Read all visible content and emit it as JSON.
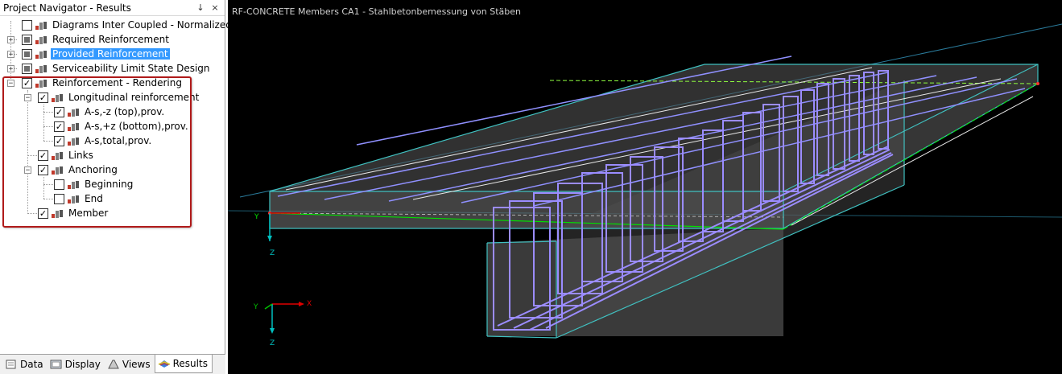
{
  "navigator": {
    "title": "Project Navigator - Results",
    "pin_glyph": "↓",
    "close_glyph": "×",
    "items": [
      {
        "label": "Diagrams Inter Coupled - Normalized",
        "checked": false,
        "expandable": false,
        "selected": false
      },
      {
        "label": "Required Reinforcement",
        "checked": "partial",
        "expandable": true,
        "selected": false
      },
      {
        "label": "Provided Reinforcement",
        "checked": "partial",
        "expandable": true,
        "selected": true
      },
      {
        "label": "Serviceability Limit State Design",
        "checked": "partial",
        "expandable": true,
        "selected": false
      },
      {
        "label": "Reinforcement - Rendering",
        "checked": true,
        "expandable": true,
        "expanded": true,
        "selected": false
      },
      {
        "label": "Longitudinal reinforcement",
        "checked": true,
        "expandable": true,
        "expanded": true,
        "selected": false
      },
      {
        "label": "A-s,-z (top),prov.",
        "checked": true,
        "selected": false
      },
      {
        "label": "A-s,+z (bottom),prov.",
        "checked": true,
        "selected": false
      },
      {
        "label": "A-s,total,prov.",
        "checked": true,
        "selected": false
      },
      {
        "label": "Links",
        "checked": true,
        "selected": false
      },
      {
        "label": "Anchoring",
        "checked": true,
        "expandable": true,
        "expanded": true,
        "selected": false
      },
      {
        "label": "Beginning",
        "checked": false,
        "selected": false
      },
      {
        "label": "End",
        "checked": false,
        "selected": false
      },
      {
        "label": "Member",
        "checked": true,
        "selected": false
      }
    ],
    "tabs": [
      {
        "label": "Data",
        "active": false
      },
      {
        "label": "Display",
        "active": false
      },
      {
        "label": "Views",
        "active": false
      },
      {
        "label": "Results",
        "active": true
      }
    ]
  },
  "viewport": {
    "title": "RF-CONCRETE Members CA1 - Stahlbetonbemessung von Stäben",
    "axes": {
      "x": "X",
      "y": "Y",
      "z": "Z"
    },
    "colors": {
      "background": "#000000",
      "concrete_edge": "#40c0c0",
      "rebar": "#9090ff",
      "member_axis": "#00e000",
      "x_axis": "#e00000",
      "z_axis": "#00c0c0"
    }
  },
  "colors": {
    "selection": "#3399ff",
    "highlight_frame": "#b01a1a"
  }
}
